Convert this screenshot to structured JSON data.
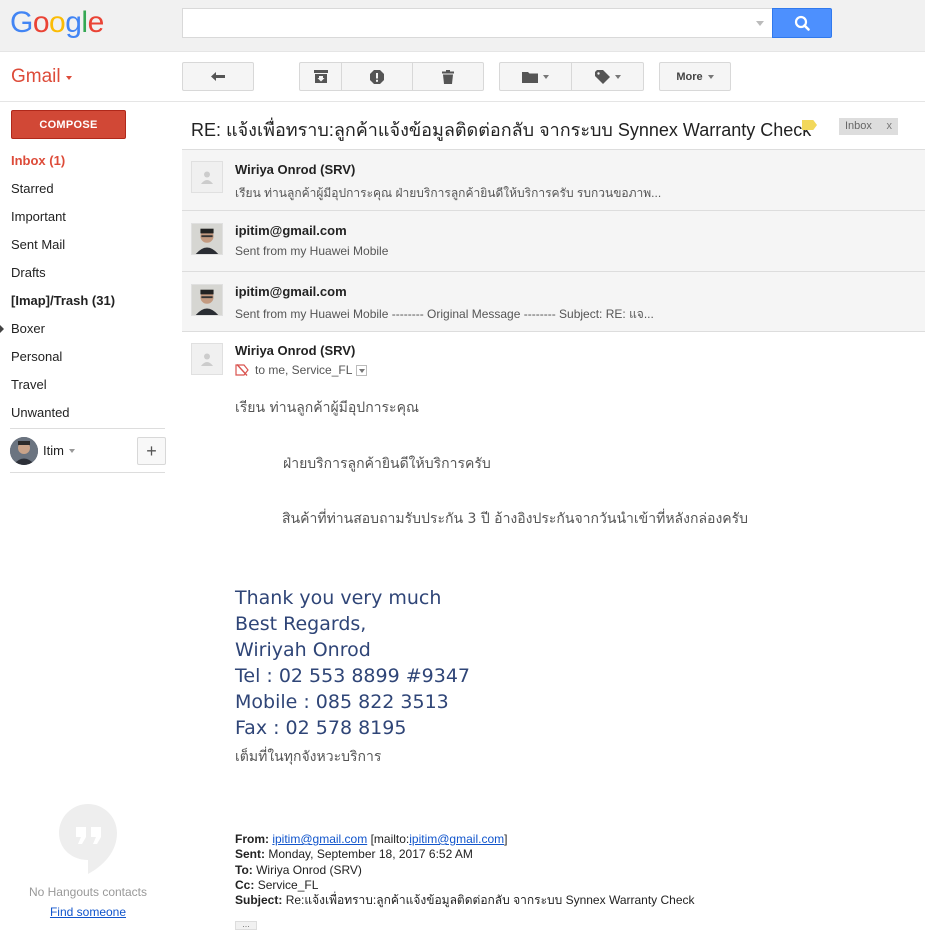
{
  "header": {
    "logo": "Google",
    "logo_colors": [
      "#4285f4",
      "#ea4335",
      "#fbbc05",
      "#4285f4",
      "#34a853",
      "#ea4335"
    ],
    "search_value": ""
  },
  "app": {
    "name": "Gmail"
  },
  "toolbar": {
    "more_label": "More"
  },
  "sidebar": {
    "compose_label": "COMPOSE",
    "items": [
      {
        "label": "Inbox (1)"
      },
      {
        "label": "Starred"
      },
      {
        "label": "Important"
      },
      {
        "label": "Sent Mail"
      },
      {
        "label": "Drafts"
      },
      {
        "label": "[Imap]/Trash (31)"
      },
      {
        "label": "Boxer"
      },
      {
        "label": "Personal"
      },
      {
        "label": "Travel"
      },
      {
        "label": "Unwanted"
      }
    ],
    "user_name": "Itim",
    "hangouts_empty": "No Hangouts contacts",
    "find_someone": "Find someone"
  },
  "thread": {
    "subject": "RE: แจ้งเพื่อทราบ:ลูกค้าแจ้งข้อมูลติดต่อกลับ จากระบบ Synnex Warranty Check",
    "label_chip": "Inbox",
    "label_chip_close": "x",
    "messages": [
      {
        "sender": "Wiriya Onrod (SRV)",
        "snippet": "เรียน ท่านลูกค้าผู้มีอุปการะคุณ ฝ่ายบริการลูกค้ายินดีให้บริการครับ รบกวนขอภาพ..."
      },
      {
        "sender": "ipitim@gmail.com",
        "snippet": "Sent from my Huawei Mobile"
      },
      {
        "sender": "ipitim@gmail.com",
        "snippet": "Sent from my Huawei Mobile -------- Original Message -------- Subject: RE: แจ..."
      }
    ],
    "open": {
      "sender": "Wiriya Onrod (SRV)",
      "to_line": "to me, Service_FL",
      "body": {
        "greeting": "เรียน ท่านลูกค้าผู้มีอุปการะคุณ",
        "line1": "ฝ่ายบริการลูกค้ายินดีให้บริการครับ",
        "line2": "สินค้าที่ท่านสอบถามรับประกัน 3 ปี อ้างอิงประกันจากวันนำเข้าที่หลังกล่องครับ"
      },
      "signature": {
        "thanks": "Thank you very much",
        "regards": "Best Regards,",
        "name": "Wiriyah Onrod",
        "tel": "Tel : 02 553 8899 #9347",
        "mobile": "Mobile : 085 822 3513",
        "fax": "Fax : 02 578 8195",
        "tagline": "เต็มที่ในทุกจังหวะบริการ"
      },
      "quoted": {
        "from_label": "From:",
        "from_email": "ipitim@gmail.com",
        "mailto_prefix": "[mailto:",
        "mailto_email": "ipitim@gmail.com",
        "mailto_suffix": "]",
        "sent_label": "Sent:",
        "sent_value": "Monday, September 18, 2017 6:52 AM",
        "to_label": "To:",
        "to_value": "Wiriya Onrod (SRV)",
        "cc_label": "Cc:",
        "cc_value": "Service_FL",
        "subject_label": "Subject:",
        "subject_value": "Re:แจ้งเพื่อทราบ:ลูกค้าแจ้งข้อมูลติดต่อกลับ จากระบบ Synnex Warranty Check"
      },
      "ellipsis": "..."
    }
  }
}
